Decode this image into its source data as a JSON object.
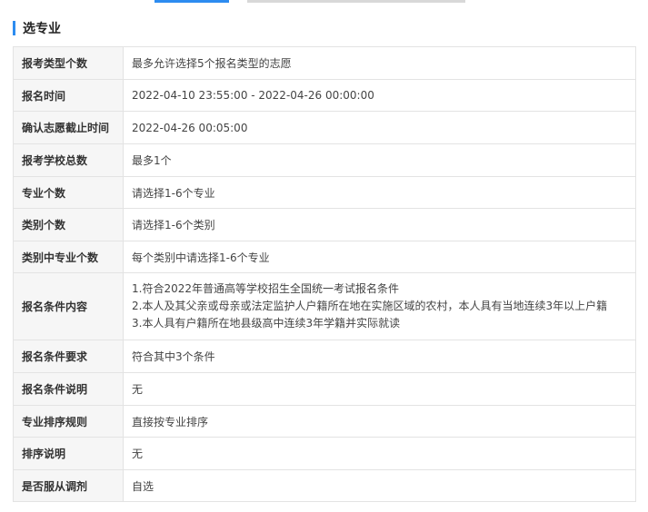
{
  "section": {
    "title": "选专业"
  },
  "rows": [
    {
      "label": "报考类型个数",
      "value": "最多允许选择5个报名类型的志愿"
    },
    {
      "label": "报名时间",
      "value": "2022-04-10 23:55:00 - 2022-04-26 00:00:00"
    },
    {
      "label": "确认志愿截止时间",
      "value": "2022-04-26 00:05:00"
    },
    {
      "label": "报考学校总数",
      "value": "最多1个"
    },
    {
      "label": "专业个数",
      "value": "请选择1-6个专业"
    },
    {
      "label": "类别个数",
      "value": "请选择1-6个类别"
    },
    {
      "label": "类别中专业个数",
      "value": "每个类别中请选择1-6个专业"
    },
    {
      "label": "报名条件内容",
      "lines": [
        "1.符合2022年普通高等学校招生全国统一考试报名条件",
        "2.本人及其父亲或母亲或法定监护人户籍所在地在实施区域的农村，本人具有当地连续3年以上户籍",
        "3.本人具有户籍所在地县级高中连续3年学籍并实际就读"
      ]
    },
    {
      "label": "报名条件要求",
      "value": "符合其中3个条件"
    },
    {
      "label": "报名条件说明",
      "value": "无"
    },
    {
      "label": "专业排序规则",
      "value": "直接按专业排序"
    },
    {
      "label": "排序说明",
      "value": "无"
    },
    {
      "label": "是否服从调剂",
      "value": "自选"
    }
  ],
  "colors": {
    "accent": "#2d8cf0",
    "label_bg": "#f6f6f6",
    "border": "#e3e3e3"
  }
}
